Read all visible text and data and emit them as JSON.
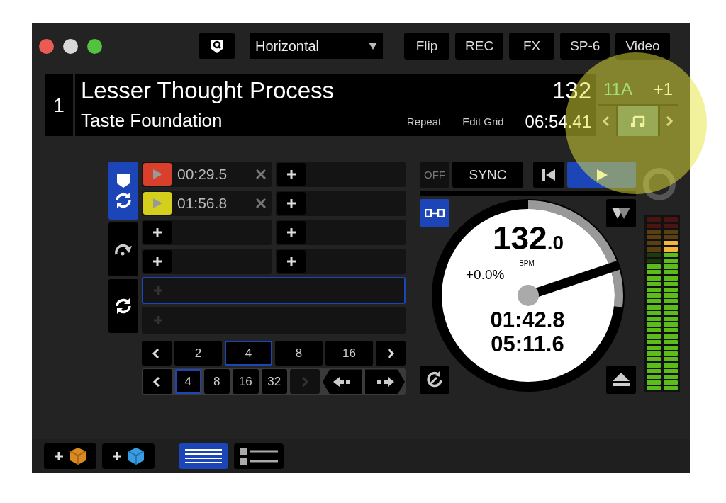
{
  "toolbar": {
    "layout_dropdown": {
      "value": "Horizontal"
    },
    "buttons": [
      "Flip",
      "REC",
      "FX",
      "SP-6",
      "Video"
    ]
  },
  "track": {
    "deck_number": "1",
    "title": "Lesser Thought Process",
    "artist": "Taste Foundation",
    "bpm": "132",
    "key": "11A",
    "key_shift": "+1",
    "repeat": "Repeat",
    "edit_grid": "Edit Grid",
    "time": "06:54.41"
  },
  "side_modes": [
    {
      "kind": "cue",
      "selected": true
    },
    {
      "kind": "roll",
      "selected": false
    },
    {
      "kind": "loop",
      "selected": false
    }
  ],
  "hotcues": [
    {
      "kind": "set",
      "time": "00:29.5",
      "color": "#d9402b"
    },
    {
      "kind": "empty"
    },
    {
      "kind": "set",
      "time": "01:56.8",
      "color": "#d4cf1c"
    },
    {
      "kind": "empty"
    },
    {
      "kind": "empty"
    },
    {
      "kind": "empty"
    },
    {
      "kind": "empty"
    },
    {
      "kind": "empty"
    }
  ],
  "saved_loops": [
    {
      "selected": true
    },
    {
      "selected": false
    }
  ],
  "auto_loop": [
    {
      "label": "2",
      "selected": false
    },
    {
      "label": "4",
      "selected": true
    },
    {
      "label": "8",
      "selected": false
    },
    {
      "label": "16",
      "selected": false
    }
  ],
  "loop_roll": [
    {
      "label": "4",
      "selected": true
    },
    {
      "label": "8",
      "selected": false
    },
    {
      "label": "16",
      "selected": false
    },
    {
      "label": "32",
      "selected": false
    }
  ],
  "loop_roll_next_disabled": true,
  "deck": {
    "keylock": "OFF",
    "sync": "SYNC",
    "playing": true,
    "bpm": "132",
    "bpm_decimal": ".0",
    "bpm_unit": "BPM",
    "pitch": "+0.0%",
    "elapsed": "01:42.8",
    "remaining": "05:11.6",
    "progress": {
      "level": 0.27
    }
  },
  "meters": [
    {
      "level": 0.74
    },
    {
      "level": 0.86
    }
  ],
  "views": [
    {
      "kind": "waveform",
      "selected": true
    },
    {
      "kind": "list",
      "selected": false
    }
  ]
}
